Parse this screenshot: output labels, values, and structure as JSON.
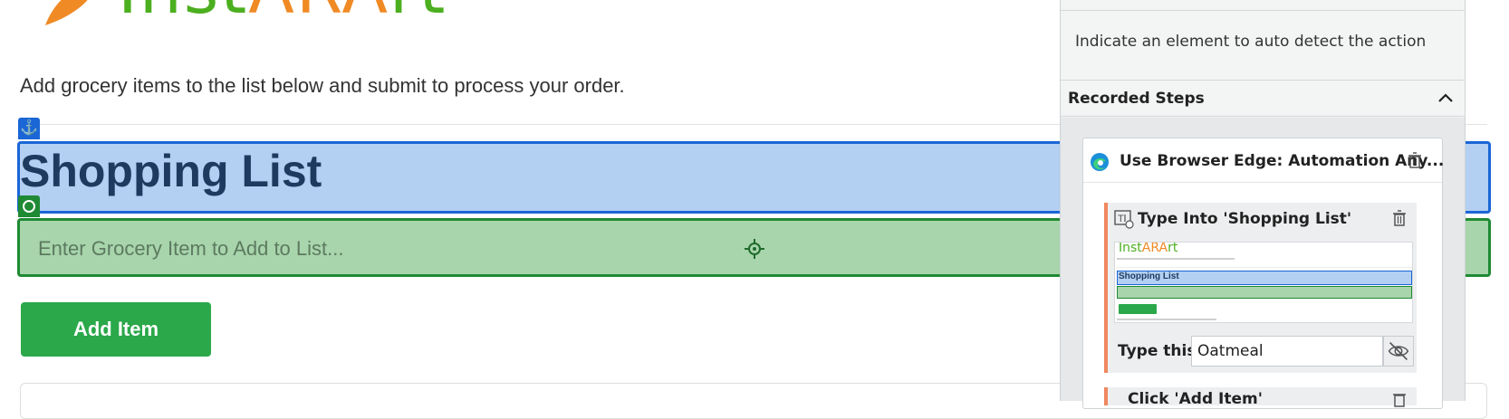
{
  "app": {
    "logo_text_left": "Inst",
    "logo_text_accent": "A",
    "logo_text_mid": "R",
    "logo_text_accent2": "A",
    "logo_text_right": "rt",
    "brand_green": "#4caf1f",
    "brand_orange": "#f08a24"
  },
  "page": {
    "intro": "Add grocery items to the list below and submit to process your order.",
    "heading": "Shopping List",
    "input_placeholder": "Enter Grocery Item to Add to List...",
    "add_button": "Add Item"
  },
  "panel": {
    "hint": "Indicate an element to auto detect the action",
    "recorded_steps_title": "Recorded Steps",
    "steps": [
      {
        "icon": "edge-icon",
        "title": "Use Browser Edge: Automation Any...",
        "children": [
          {
            "icon": "type-into-icon",
            "title": "Type Into 'Shopping List'",
            "thumbnail_heading": "Shopping List",
            "type_label": "Type this",
            "type_value": "Oatmeal"
          },
          {
            "icon": "click-icon",
            "title": "Click 'Add Item'"
          }
        ]
      }
    ]
  },
  "colors": {
    "highlight_blue": "#1a66d6",
    "highlight_green": "#1f8a33",
    "button_green": "#2aa84a",
    "step_accent": "#f0875f"
  }
}
